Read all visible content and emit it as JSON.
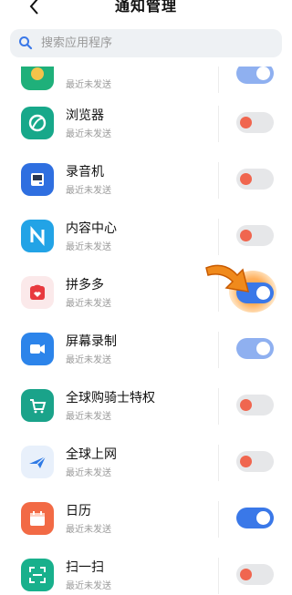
{
  "header": {
    "title": "通知管理",
    "back_icon": "chevron-left-icon"
  },
  "search": {
    "placeholder": "搜索应用程序",
    "icon": "search-icon"
  },
  "colors": {
    "accent": "#3a78e8",
    "off_knob": "#f0664f",
    "off_track": "#e6e7e9",
    "highlight": "#ff9a30"
  },
  "apps": [
    {
      "name": "",
      "status": "最近未发送",
      "icon": "app-icon-partial",
      "enabled": true
    },
    {
      "name": "浏览器",
      "status": "最近未发送",
      "icon": "browser-icon",
      "enabled": false
    },
    {
      "name": "录音机",
      "status": "最近未发送",
      "icon": "recorder-icon",
      "enabled": false
    },
    {
      "name": "内容中心",
      "status": "最近未发送",
      "icon": "content-center-icon",
      "enabled": false
    },
    {
      "name": "拼多多",
      "status": "最近未发送",
      "icon": "pinduoduo-icon",
      "enabled": true
    },
    {
      "name": "屏幕录制",
      "status": "最近未发送",
      "icon": "screen-record-icon",
      "enabled": true
    },
    {
      "name": "全球购骑士特权",
      "status": "最近未发送",
      "icon": "shopping-cart-icon",
      "enabled": false
    },
    {
      "name": "全球上网",
      "status": "最近未发送",
      "icon": "airplane-icon",
      "enabled": false
    },
    {
      "name": "日历",
      "status": "最近未发送",
      "icon": "calendar-icon",
      "enabled": true
    },
    {
      "name": "扫一扫",
      "status": "最近未发送",
      "icon": "scan-icon",
      "enabled": false
    }
  ]
}
